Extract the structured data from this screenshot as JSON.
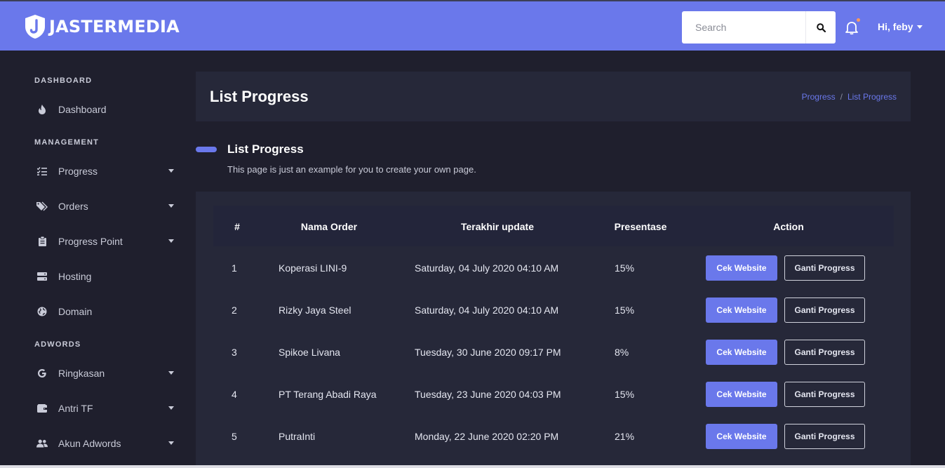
{
  "brand": {
    "name": "JASTERMEDIA"
  },
  "header": {
    "search_placeholder": "Search",
    "user_greeting": "Hi, feby",
    "has_notification": true
  },
  "sidebar": {
    "sections": [
      {
        "heading": "DASHBOARD"
      },
      {
        "heading": "MANAGEMENT"
      },
      {
        "heading": "ADWORDS"
      }
    ],
    "items": [
      {
        "label": "Dashboard",
        "icon": "fire-icon",
        "has_submenu": false
      },
      {
        "label": "Progress",
        "icon": "tasks-icon",
        "has_submenu": true
      },
      {
        "label": "Orders",
        "icon": "tags-icon",
        "has_submenu": true
      },
      {
        "label": "Progress Point",
        "icon": "clipboard-icon",
        "has_submenu": true
      },
      {
        "label": "Hosting",
        "icon": "server-icon",
        "has_submenu": false
      },
      {
        "label": "Domain",
        "icon": "globe-icon",
        "has_submenu": false
      },
      {
        "label": "Ringkasan",
        "icon": "google-icon",
        "has_submenu": true
      },
      {
        "label": "Antri TF",
        "icon": "wallet-icon",
        "has_submenu": true
      },
      {
        "label": "Akun Adwords",
        "icon": "users-icon",
        "has_submenu": true
      }
    ]
  },
  "page": {
    "title": "List Progress",
    "breadcrumb": [
      "Progress",
      "List Progress"
    ],
    "section_title": "List Progress",
    "section_description": "This page is just an example for you to create your own page."
  },
  "table": {
    "columns": [
      "#",
      "Nama Order",
      "Terakhir update",
      "Presentase",
      "Action"
    ],
    "rows": [
      {
        "no": "1",
        "name": "Koperasi LINI-9",
        "updated": "Saturday, 04 July 2020 04:10 AM",
        "percent": "15%"
      },
      {
        "no": "2",
        "name": "Rizky Jaya Steel",
        "updated": "Saturday, 04 July 2020 04:10 AM",
        "percent": "15%"
      },
      {
        "no": "3",
        "name": "Spikoe Livana",
        "updated": "Tuesday, 30 June 2020 09:17 PM",
        "percent": "8%"
      },
      {
        "no": "4",
        "name": "PT Terang Abadi Raya",
        "updated": "Tuesday, 23 June 2020 04:03 PM",
        "percent": "15%"
      },
      {
        "no": "5",
        "name": "PutraInti",
        "updated": "Monday, 22 June 2020 02:20 PM",
        "percent": "21%"
      }
    ],
    "action_primary": "Cek Website",
    "action_secondary": "Ganti Progress"
  },
  "colors": {
    "accent": "#6a78eb",
    "background": "#1f1f2d",
    "card": "#262839",
    "notification_dot": "#ff9a5c"
  }
}
